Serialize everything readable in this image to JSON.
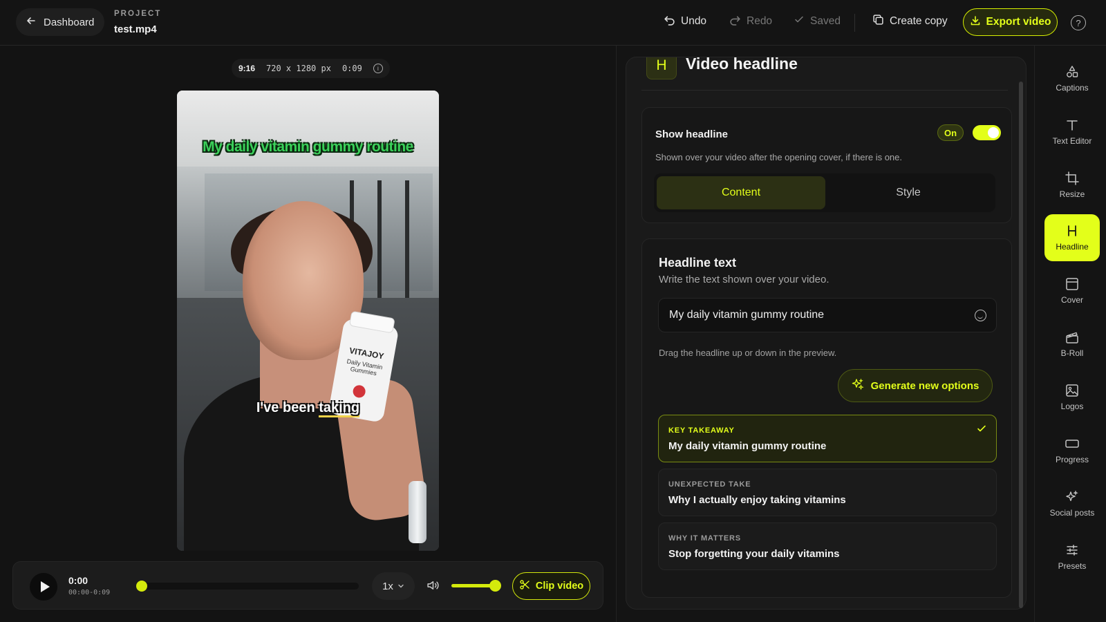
{
  "topbar": {
    "back_label": "Dashboard",
    "project_label": "PROJECT",
    "project_name": "test.mp4",
    "undo": "Undo",
    "redo": "Redo",
    "saved": "Saved",
    "create_copy": "Create copy",
    "export": "Export video",
    "help": "?"
  },
  "preview": {
    "ratio": "9:16",
    "resolution": "720 x 1280 px",
    "duration": "0:09",
    "headline_overlay": "My daily vitamin gummy routine",
    "caption_pre": "I've been ",
    "caption_hl": "taking",
    "bottle_brand": "VITAJOY",
    "bottle_sub": "Daily Vitamin Gummies"
  },
  "player": {
    "time_now": "0:00",
    "time_range": "00:00-0:09",
    "progress": 0.0,
    "volume": 0.9,
    "speed": "1x",
    "clip_label": "Clip video"
  },
  "panel": {
    "badge": "H",
    "title": "Video headline",
    "show_label": "Show headline",
    "on_label": "On",
    "show_desc": "Shown over your video after the opening cover, if there is one.",
    "tabs": {
      "content": "Content",
      "style": "Style"
    },
    "headline_title": "Headline text",
    "headline_desc": "Write the text shown over your video.",
    "headline_value": "My daily vitamin gummy routine",
    "drag_hint": "Drag the headline up or down in the preview.",
    "generate": "Generate new options",
    "options": [
      {
        "tag": "KEY TAKEAWAY",
        "text": "My daily vitamin gummy routine",
        "selected": true
      },
      {
        "tag": "UNEXPECTED TAKE",
        "text": "Why I actually enjoy taking vitamins",
        "selected": false
      },
      {
        "tag": "WHY IT MATTERS",
        "text": "Stop forgetting your daily vitamins",
        "selected": false
      }
    ]
  },
  "sidebar": {
    "items": [
      {
        "label": "Captions",
        "icon": "shapes-icon"
      },
      {
        "label": "Text Editor",
        "icon": "text-icon"
      },
      {
        "label": "Resize",
        "icon": "crop-icon"
      },
      {
        "label": "Headline",
        "icon": "heading-icon",
        "active": true
      },
      {
        "label": "Cover",
        "icon": "cover-icon"
      },
      {
        "label": "B-Roll",
        "icon": "clapper-icon"
      },
      {
        "label": "Logos",
        "icon": "image-icon"
      },
      {
        "label": "Progress",
        "icon": "progress-icon"
      },
      {
        "label": "Social posts",
        "icon": "sparkle-icon"
      },
      {
        "label": "Presets",
        "icon": "sliders-icon"
      }
    ]
  },
  "colors": {
    "accent": "#e3ff1a",
    "background": "#141414",
    "panel": "#1a1a1a",
    "headline_green": "#3bd15a"
  }
}
